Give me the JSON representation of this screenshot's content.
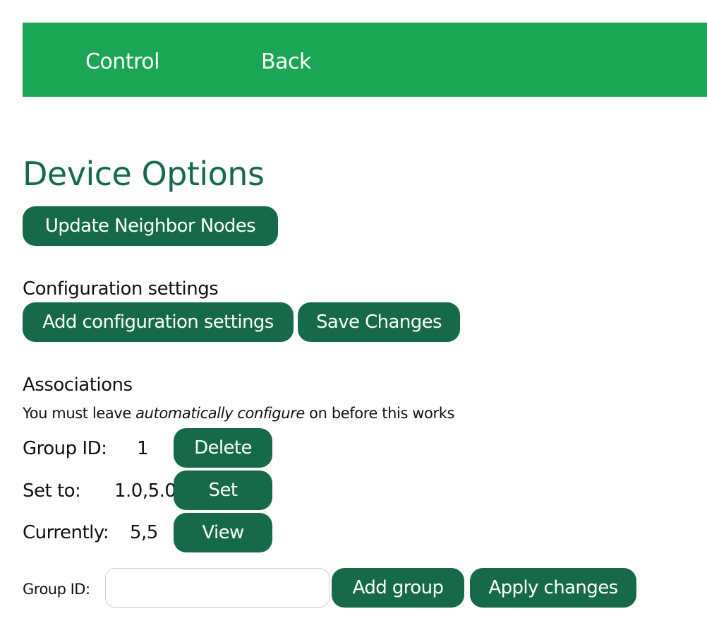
{
  "nav": {
    "control_label": "Control",
    "back_label": "Back"
  },
  "page": {
    "title": "Device Options"
  },
  "buttons": {
    "update_neighbor_nodes": "Update Neighbor Nodes",
    "add_configuration_settings": "Add configuration settings",
    "save_changes": "Save Changes",
    "delete": "Delete",
    "set": "Set",
    "view": "View",
    "add_group": "Add group",
    "apply_changes": "Apply changes"
  },
  "sections": {
    "configuration_heading": "Configuration settings",
    "associations_heading": "Associations"
  },
  "associations": {
    "note_before": "You must leave ",
    "note_emphasis": "automatically configure",
    "note_after": " on before this works",
    "group_id_label": "Group ID:",
    "group_id_value": "1",
    "set_to_label": "Set to:",
    "set_to_value": "1.0,5.0",
    "currently_label": "Currently:",
    "currently_value": "5,5"
  },
  "new_group": {
    "label": "Group ID:",
    "input_value": "",
    "input_placeholder": ""
  },
  "colors": {
    "nav_background": "#1aa655",
    "button_background": "#166a4a",
    "title_color": "#166a4a"
  }
}
